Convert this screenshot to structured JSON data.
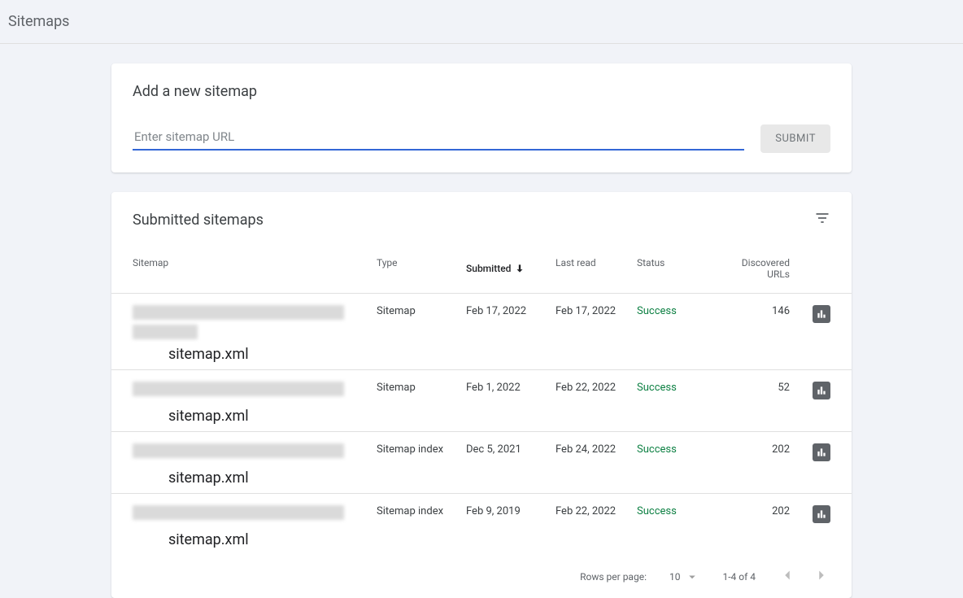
{
  "header": {
    "title": "Sitemaps"
  },
  "add": {
    "title": "Add a new sitemap",
    "placeholder": "Enter sitemap URL",
    "submit": "SUBMIT"
  },
  "submitted": {
    "title": "Submitted sitemaps",
    "columns": {
      "sitemap": "Sitemap",
      "type": "Type",
      "submitted": "Submitted",
      "last_read": "Last read",
      "status": "Status",
      "discovered": "Discovered URLs"
    },
    "rows": [
      {
        "name": "sitemap.xml",
        "type": "Sitemap",
        "submitted": "Feb 17, 2022",
        "last_read": "Feb 17, 2022",
        "status": "Success",
        "discovered": "146"
      },
      {
        "name": "sitemap.xml",
        "type": "Sitemap",
        "submitted": "Feb 1, 2022",
        "last_read": "Feb 22, 2022",
        "status": "Success",
        "discovered": "52"
      },
      {
        "name": "sitemap.xml",
        "type": "Sitemap index",
        "submitted": "Dec 5, 2021",
        "last_read": "Feb 24, 2022",
        "status": "Success",
        "discovered": "202"
      },
      {
        "name": "sitemap.xml",
        "type": "Sitemap index",
        "submitted": "Feb 9, 2019",
        "last_read": "Feb 22, 2022",
        "status": "Success",
        "discovered": "202"
      }
    ]
  },
  "pagination": {
    "rows_label": "Rows per page:",
    "rows_value": "10",
    "range": "1-4 of 4"
  }
}
